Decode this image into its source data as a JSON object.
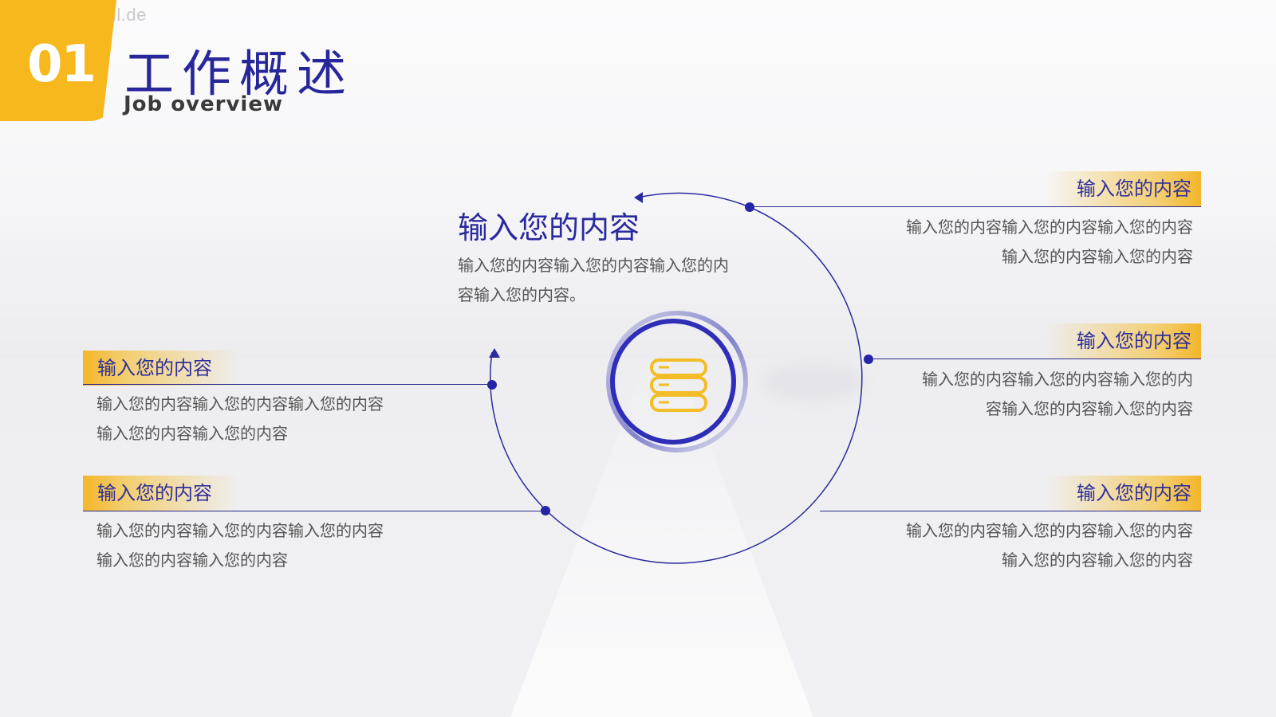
{
  "watermark": "https://ppt.pkll.de",
  "header": {
    "number": "01",
    "title": "工作概述",
    "subtitle": "Job overview"
  },
  "center": {
    "heading": "输入您的内容",
    "description": "输入您的内容输入您的内容输入您的内容输入您的内容。",
    "icon": "database-stack-icon"
  },
  "items": {
    "right1": {
      "label": "输入您的内容",
      "text": "输入您的内容输入您的内容输入您的内容\n输入您的内容输入您的内容"
    },
    "right2": {
      "label": "输入您的内容",
      "text": "输入您的内容输入您的内容输入您的内\n容输入您的内容输入您的内容"
    },
    "right3": {
      "label": "输入您的内容",
      "text": "输入您的内容输入您的内容输入您的内容\n输入您的内容输入您的内容"
    },
    "left1": {
      "label": "输入您的内容",
      "text": "输入您的内容输入您的内容输入您的内容\n输入您的内容输入您的内容"
    },
    "left2": {
      "label": "输入您的内容",
      "text": "输入您的内容输入您的内容输入您的内容\n输入您的内容输入您的内容"
    }
  },
  "colors": {
    "accent_yellow": "#f7b81d",
    "accent_blue": "#2b2ba8"
  }
}
